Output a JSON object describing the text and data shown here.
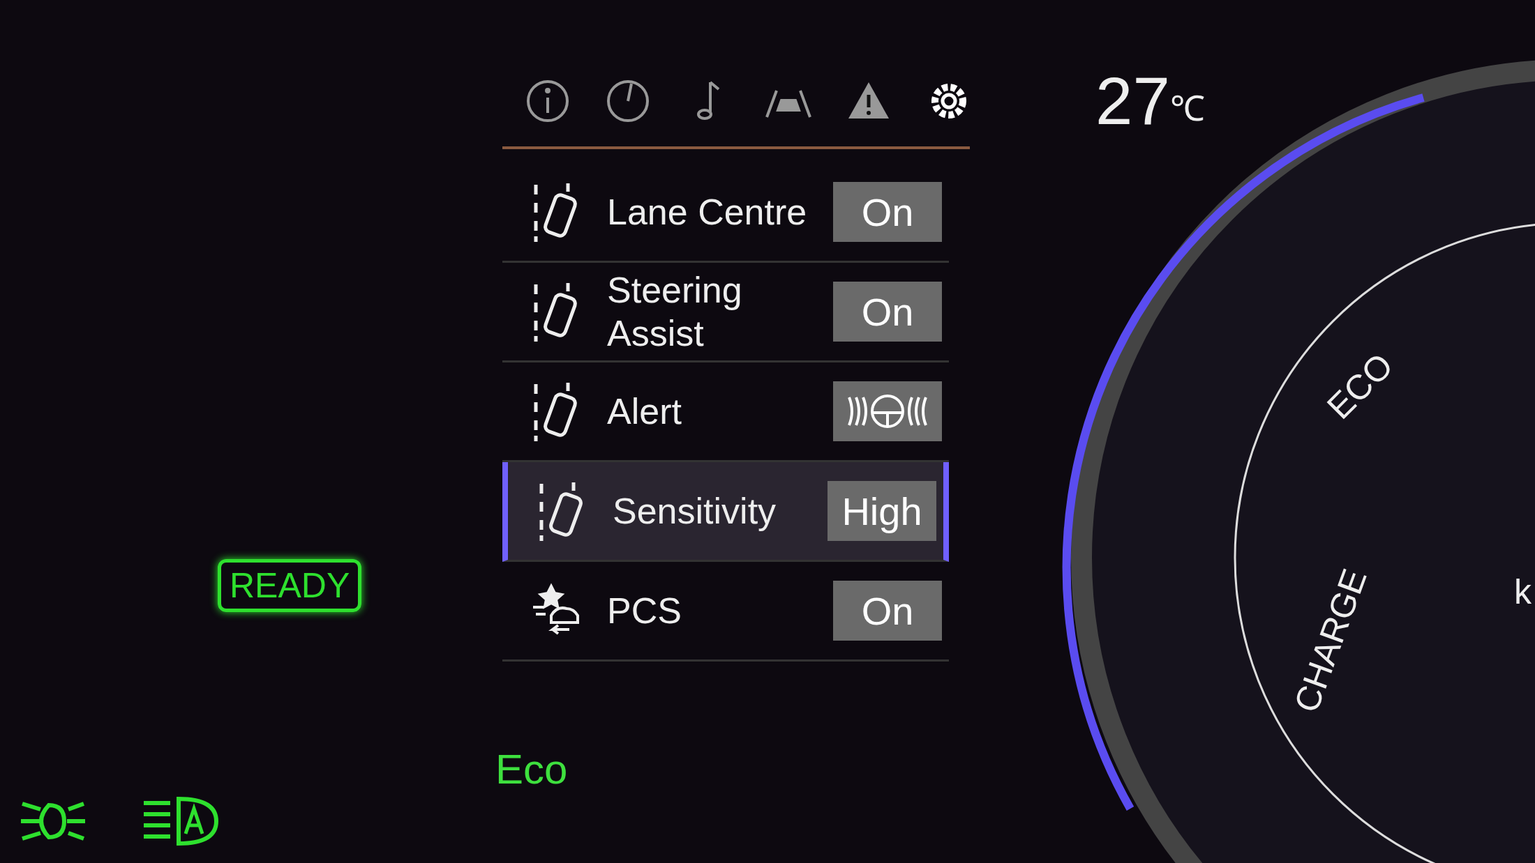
{
  "tabs": [
    {
      "kind": "info",
      "selected": false
    },
    {
      "kind": "gauge",
      "selected": false
    },
    {
      "kind": "music",
      "selected": false
    },
    {
      "kind": "car",
      "selected": false
    },
    {
      "kind": "warning",
      "selected": false
    },
    {
      "kind": "settings",
      "selected": true
    }
  ],
  "temperature": {
    "value": "27",
    "unit": "℃"
  },
  "menu": [
    {
      "label": "Lane Centre",
      "kind": "text",
      "value": "On",
      "selected": false
    },
    {
      "label": "Steering Assist",
      "kind": "text",
      "value": "On",
      "selected": false
    },
    {
      "label": "Alert",
      "kind": "wheel",
      "selected": false
    },
    {
      "label": "Sensitivity",
      "kind": "text",
      "value": "High",
      "selected": true
    },
    {
      "label": "PCS",
      "kind": "text",
      "value": "On",
      "selected": false
    }
  ],
  "ready": "READY",
  "drive_mode": "Eco",
  "gauge": {
    "labels": [
      "ECO",
      "CHARGE"
    ],
    "unit": "k"
  }
}
